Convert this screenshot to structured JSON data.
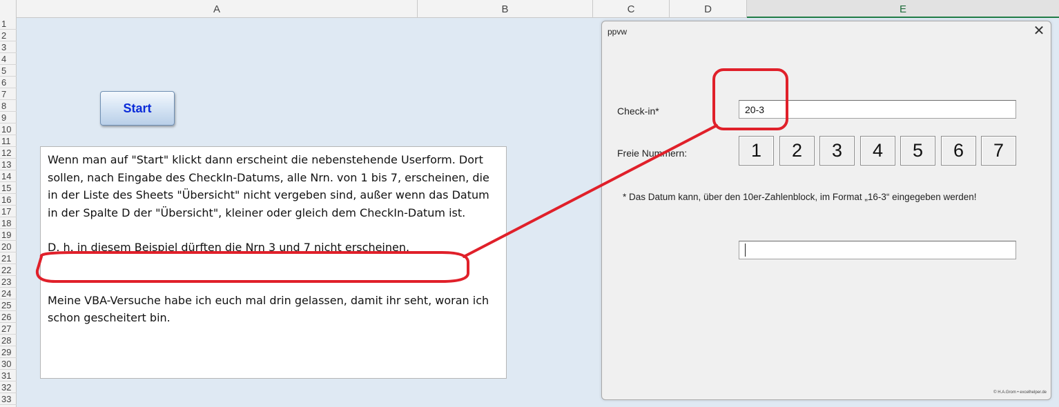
{
  "spreadsheet": {
    "columns": [
      {
        "key": "A",
        "label": "A"
      },
      {
        "key": "B",
        "label": "B"
      },
      {
        "key": "C",
        "label": "C"
      },
      {
        "key": "D",
        "label": "D"
      },
      {
        "key": "E",
        "label": "E"
      }
    ],
    "rows": [
      "1",
      "2",
      "3",
      "4",
      "5",
      "6",
      "7",
      "8",
      "9",
      "10",
      "11",
      "12",
      "13",
      "14",
      "15",
      "16",
      "17",
      "18",
      "19",
      "20",
      "21",
      "22",
      "23",
      "24",
      "25",
      "26",
      "27",
      "28",
      "29",
      "30",
      "31",
      "32",
      "33"
    ],
    "start_button_label": "Start",
    "textbox": {
      "paragraph1": "Wenn man auf \"Start\" klickt dann erscheint die nebenstehende Userform. Dort sollen, nach Eingabe des CheckIn-Datums, alle Nrn. von 1 bis 7, erscheinen, die in der Liste des Sheets \"Übersicht\" nicht vergeben sind, außer wenn das Datum in der Spalte D der \"Übersicht\", kleiner oder gleich dem CheckIn-Datum ist.",
      "paragraph2": "D. h. in diesem Beispiel dürften die Nrn 3 und 7 nicht erscheinen.",
      "paragraph3": "Meine VBA-Versuche habe ich euch mal drin gelassen, damit ihr seht, woran ich schon gescheitert bin."
    }
  },
  "userform": {
    "title": "ppvw",
    "close_symbol": "✕",
    "checkin_label": "Check-in*",
    "checkin_value": "20-3",
    "freie_label": "Freie Nummern:",
    "numbers": [
      "1",
      "2",
      "3",
      "4",
      "5",
      "6",
      "7"
    ],
    "note": "* Das Datum kann, über den 10er-Zahlenblock, im Format „16-3“ eingegeben werden!",
    "bottom_value": "",
    "copyright": "© H.A.Grom • excelhelper.de"
  },
  "annotation": {
    "color": "#e0202a"
  }
}
